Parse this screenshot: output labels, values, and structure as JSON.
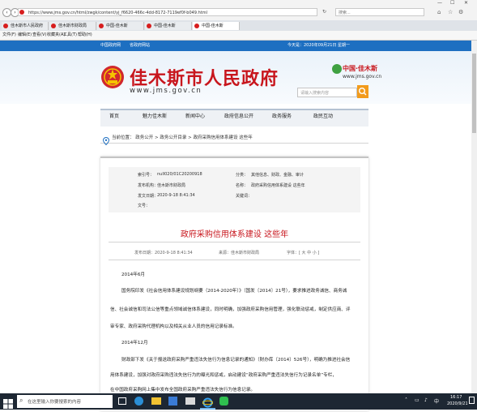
{
  "browser": {
    "url": "https://www.jms.gov.cn/html/zwgk/content/yj_f6620-466c-4dd-8172-7119ef0f-b049.html",
    "search_placeholder": "搜索...",
    "tabs": [
      "佳木斯市人民政府",
      "佳木斯市财政局",
      "中国-佳木斯",
      "中国-佳木斯",
      "中国-佳木斯"
    ],
    "menu": [
      "文件(F)",
      "编辑(E)",
      "查看(V)",
      "收藏夹(A)",
      "工具(T)",
      "帮助(H)"
    ]
  },
  "site": {
    "top_links": [
      "中国政府网",
      "省政府网站"
    ],
    "date_text": "今天是：2020年09月21日 星期一",
    "logo_title": "佳木斯市人民政府",
    "logo_url": "www.jms.gov.cn",
    "brand_name": "中国·佳木斯",
    "brand_url": "www.jms.gov.cn",
    "search_placeholder": "请输入搜索内容",
    "nav": [
      "首页",
      "魅力佳木斯",
      "新闻中心",
      "政府信息公开",
      "政务服务",
      "政民互动"
    ],
    "crumbs": {
      "prefix": "当前位置：",
      "items": [
        "政务公开",
        "政务公开目录",
        "政府采购信用体系建设 这些年"
      ],
      "sep": ">"
    }
  },
  "meta": {
    "rows": [
      {
        "label": "索引号：",
        "value": "null020/01C20200918",
        "label2": "分类：",
        "value2": "其他信息、财政、金融、审计"
      },
      {
        "label": "发布机构：",
        "value": "佳木斯市财政局",
        "label2": "名称：",
        "value2": "政府采购信用体系建设 这些年"
      },
      {
        "label": "发文日期：",
        "value": "2020-9-18 8:41:34",
        "label2": "关键词：",
        "value2": ""
      },
      {
        "label": "文号：",
        "value": "",
        "label2": "",
        "value2": ""
      }
    ]
  },
  "article": {
    "title": "政府采购信用体系建设 这些年",
    "pub_time": "发布日期：2020-9-18 8:41:34",
    "source": "来源：佳木斯市财政局",
    "font_size": "字体：[ 大 中 小 ]",
    "lines": [
      "2014年6月",
      "国务院印发《社会信用体系建设规划纲要（2014-2020年）》（国发〔2014〕21号），要求推进政务诚信、商务诚",
      "信、社会诚信和司法公信等重点领域诚信体系建设，同时明确，加强政府采购信用管理，强化联动惩戒，制定供应商、评",
      "审专家、政府采购代理机构以及相关从业人员的信用记录标准。",
      "2014年12月",
      "财政部下发《关于报送政府采购严重违法失信行为信息记录的通知》（财办库〔2014〕526号），明确为推进社会信",
      "用体系建设，加强对政府采购违法失信行为的曝光和惩戒，启动建设“政府采购严重违法失信行为记录名单”专栏，",
      "在中国政府采购网上集中发布全国政府采购严重违法失信行为信息记录。"
    ]
  },
  "taskbar": {
    "search_placeholder": "在这里输入你要搜索的内容",
    "time": "16:17",
    "date": "2020/9/21",
    "tray": "中"
  },
  "colors": {
    "brand_red": "#c8161d",
    "strip_blue": "#1d6fc1",
    "search_orange": "#f29b1b"
  }
}
